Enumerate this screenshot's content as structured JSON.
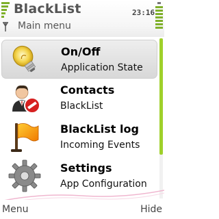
{
  "header": {
    "app_title": "BlackList",
    "subtitle": "Main menu",
    "clock": "23:16"
  },
  "menu": {
    "items": [
      {
        "label": "On/Off",
        "sublabel": "Application State",
        "icon": "lightbulb-icon",
        "selected": true
      },
      {
        "label": "Contacts",
        "sublabel": "BlackList",
        "icon": "contact-blocked-icon",
        "selected": false
      },
      {
        "label": "BlackList log",
        "sublabel": "Incoming Events",
        "icon": "flag-icon",
        "selected": false
      },
      {
        "label": "Settings",
        "sublabel": "App Configuration",
        "icon": "gear-icon",
        "selected": false
      }
    ]
  },
  "softkeys": {
    "left": "Menu",
    "right": "Hide"
  },
  "colors": {
    "accent": "#9fd02a",
    "selection": "#dcdcdc",
    "title": "#555555"
  }
}
